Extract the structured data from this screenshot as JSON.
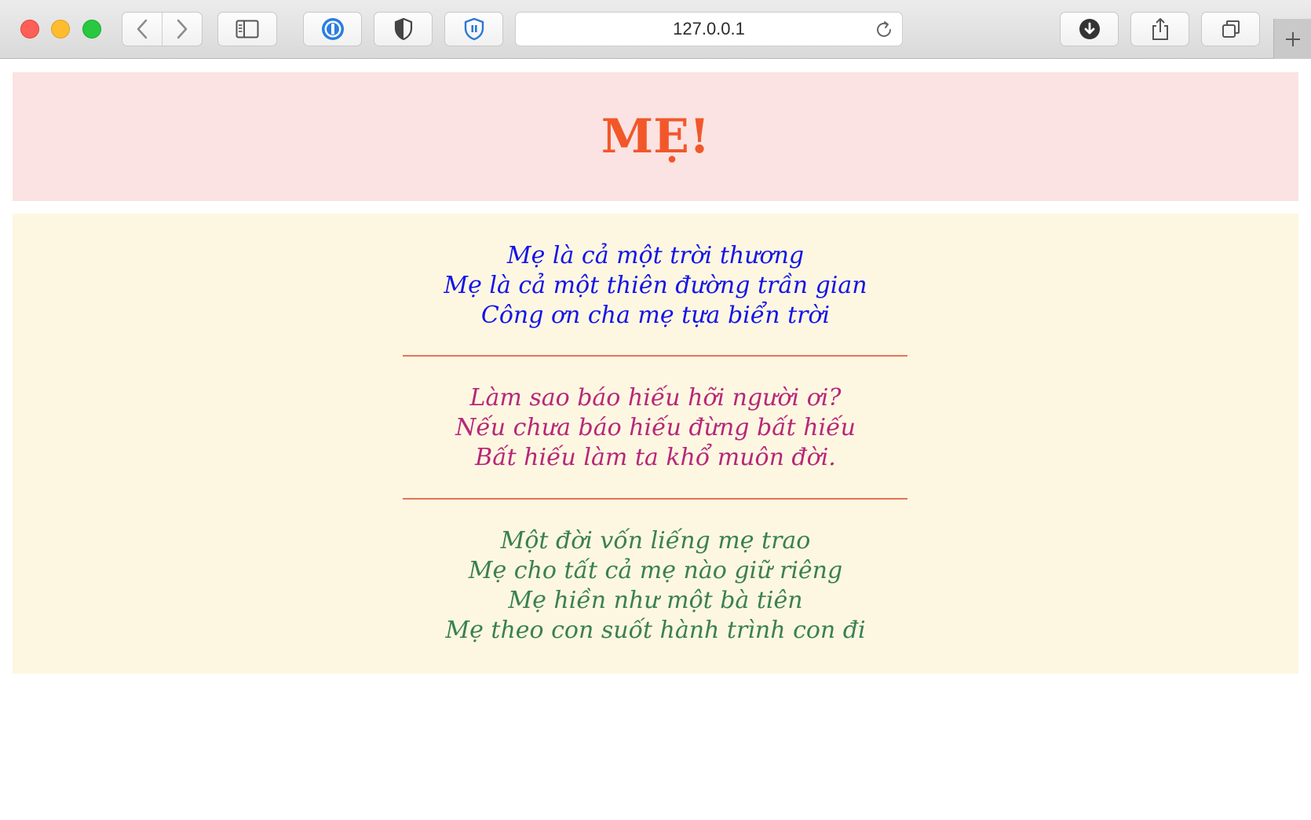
{
  "browser": {
    "url": "127.0.0.1",
    "icons": {
      "back": "chevron-left-icon",
      "forward": "chevron-right-icon",
      "sidebar": "sidebar-icon",
      "password_manager": "1password-icon",
      "privacy": "shield-half-icon",
      "extension": "shield-pause-icon",
      "reload": "reload-icon",
      "download": "download-icon",
      "share": "share-icon",
      "tabs": "tabs-overview-icon",
      "new_tab": "plus-icon"
    }
  },
  "page": {
    "title": "MẸ!",
    "stanzas": [
      {
        "color": "#1414e8",
        "lines": [
          "Mẹ là cả một trời thương",
          "Mẹ là cả một thiên đường trần gian",
          "Công ơn cha mẹ tựa biển trời"
        ]
      },
      {
        "color": "#b8267a",
        "lines": [
          "Làm sao báo hiếu hỡi người ơi?",
          "Nếu chưa báo hiếu đừng bất hiếu",
          "Bất hiếu làm ta khổ muôn đời."
        ]
      },
      {
        "color": "#3a8050",
        "lines": [
          "Một đời vốn liếng mẹ trao",
          "Mẹ cho tất cả mẹ nào giữ riêng",
          "Mẹ hiền như một bà tiên",
          "Mẹ theo con suốt hành trình con đi"
        ]
      }
    ],
    "colors": {
      "title": "#f2572a",
      "header_background": "#fae3e2",
      "poem_background": "#fdf7e1",
      "divider": "#e8735a"
    }
  }
}
